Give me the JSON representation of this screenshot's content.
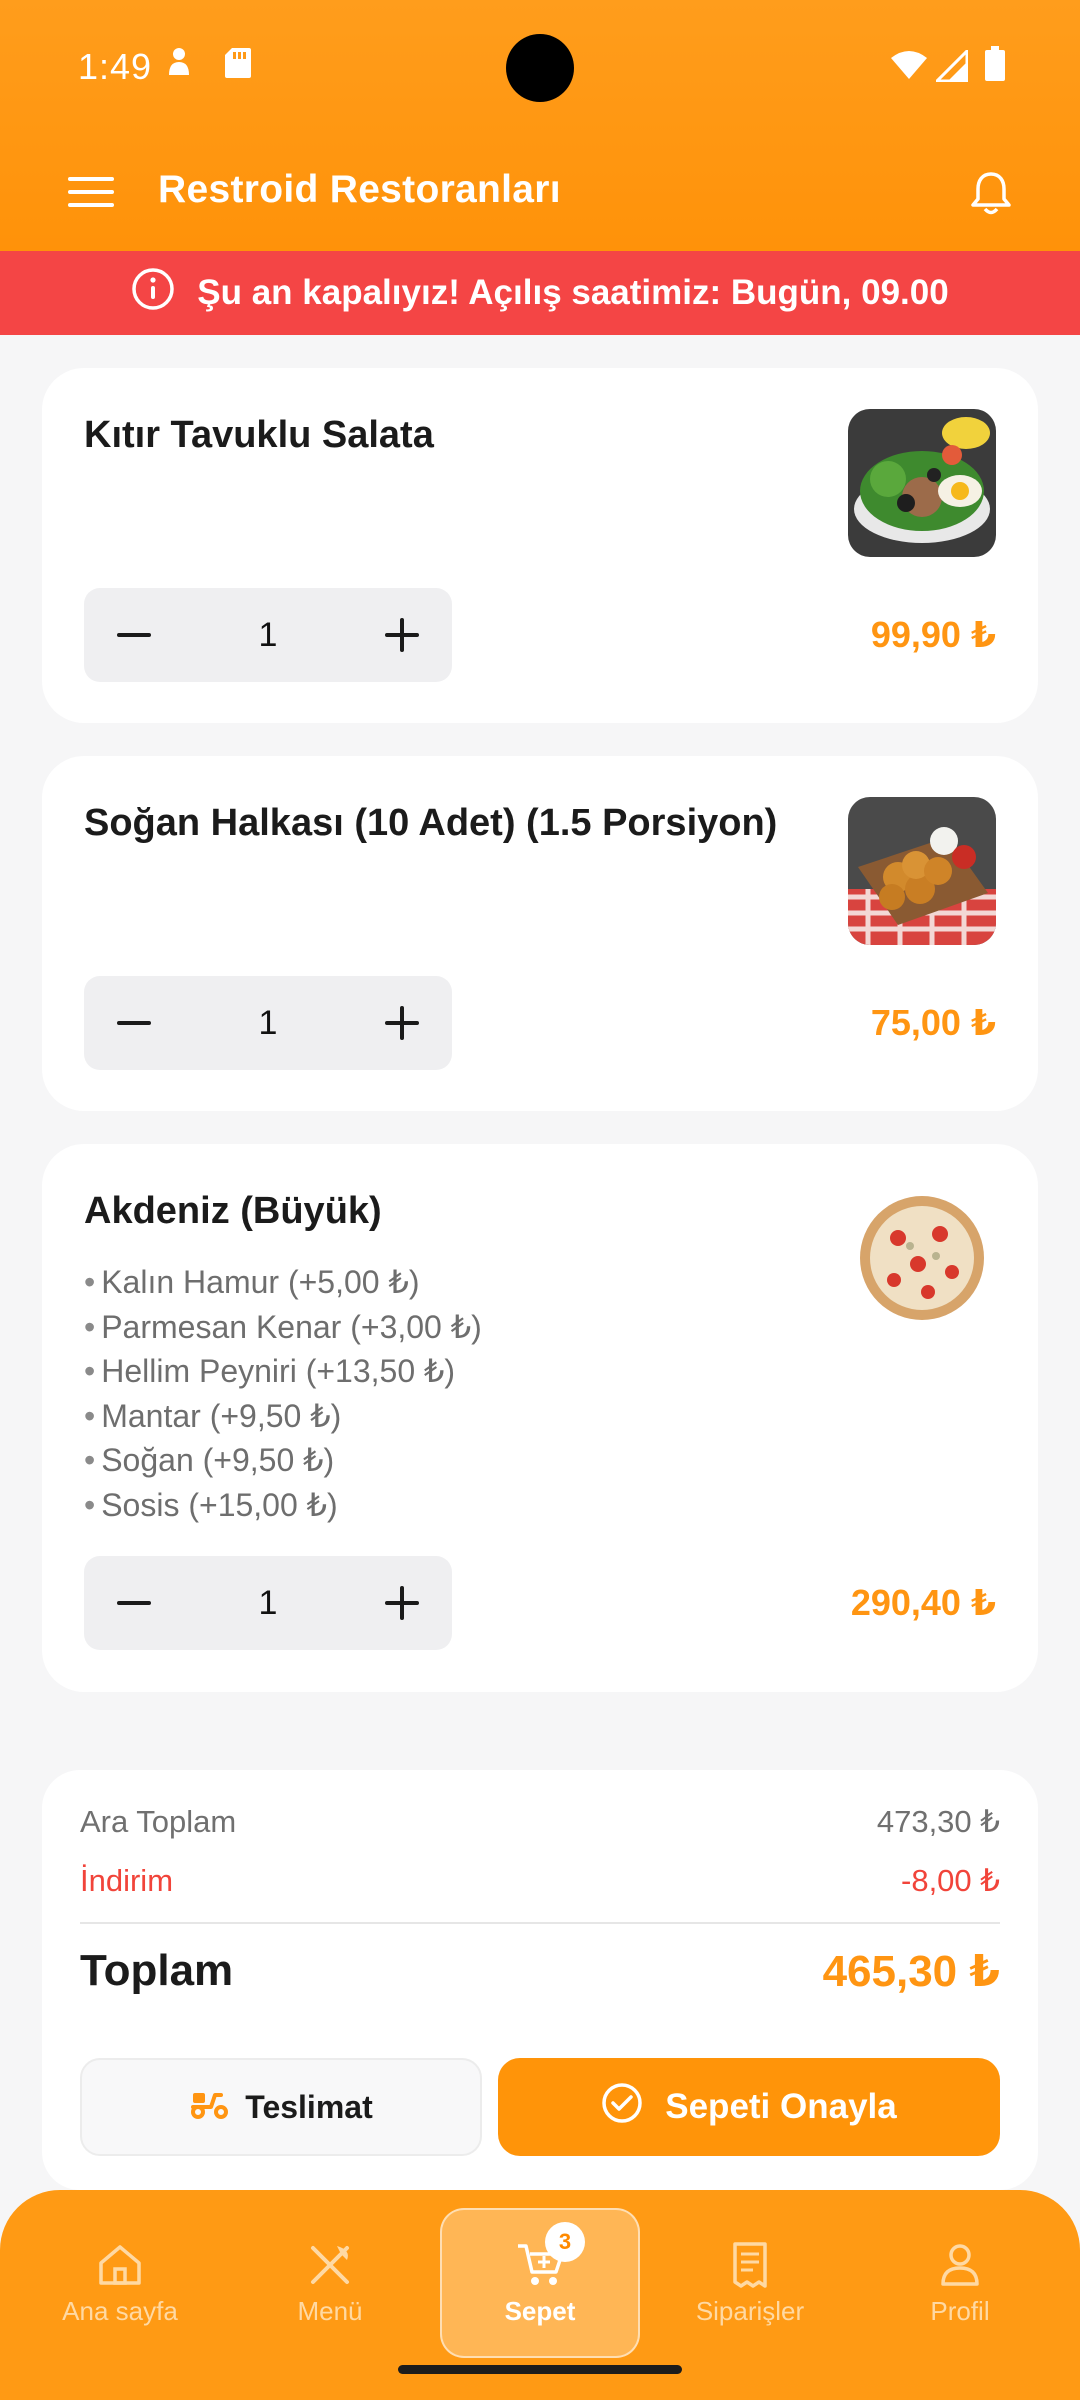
{
  "status_bar": {
    "time": "1:49"
  },
  "app_bar": {
    "title": "Restroid Restoranları"
  },
  "banner": {
    "text": "Şu an kapalıyız! Açılış saatimiz: Bugün, 09.00"
  },
  "cart_items": [
    {
      "name": "Kıtır Tavuklu Salata",
      "quantity": "1",
      "price": "99,90 ₺",
      "options": []
    },
    {
      "name": "Soğan Halkası (10 Adet) (1.5 Porsiyon)",
      "quantity": "1",
      "price": "75,00 ₺",
      "options": []
    },
    {
      "name": "Akdeniz (Büyük)",
      "quantity": "1",
      "price": "290,40 ₺",
      "options": [
        "Kalın Hamur (+5,00 ₺)",
        "Parmesan Kenar (+3,00 ₺)",
        "Hellim Peyniri (+13,50 ₺)",
        "Mantar (+9,50 ₺)",
        "Soğan (+9,50 ₺)",
        "Sosis (+15,00 ₺)"
      ]
    }
  ],
  "summary": {
    "subtotal_label": "Ara Toplam",
    "subtotal_value": "473,30 ₺",
    "discount_label": "İndirim",
    "discount_value": "-8,00 ₺",
    "total_label": "Toplam",
    "total_value": "465,30 ₺",
    "delivery_button": "Teslimat",
    "confirm_button": "Sepeti Onayla"
  },
  "bottom_nav": {
    "items": [
      {
        "label": "Ana sayfa",
        "icon": "home-icon"
      },
      {
        "label": "Menü",
        "icon": "fork-knife-icon"
      },
      {
        "label": "Sepet",
        "icon": "cart-icon",
        "badge": "3",
        "active": true
      },
      {
        "label": "Siparişler",
        "icon": "receipt-icon"
      },
      {
        "label": "Profil",
        "icon": "user-icon"
      }
    ]
  },
  "colors": {
    "primary": "#ff9409",
    "banner": "#f44545",
    "price": "#ff9512",
    "discount": "#f1443a"
  }
}
